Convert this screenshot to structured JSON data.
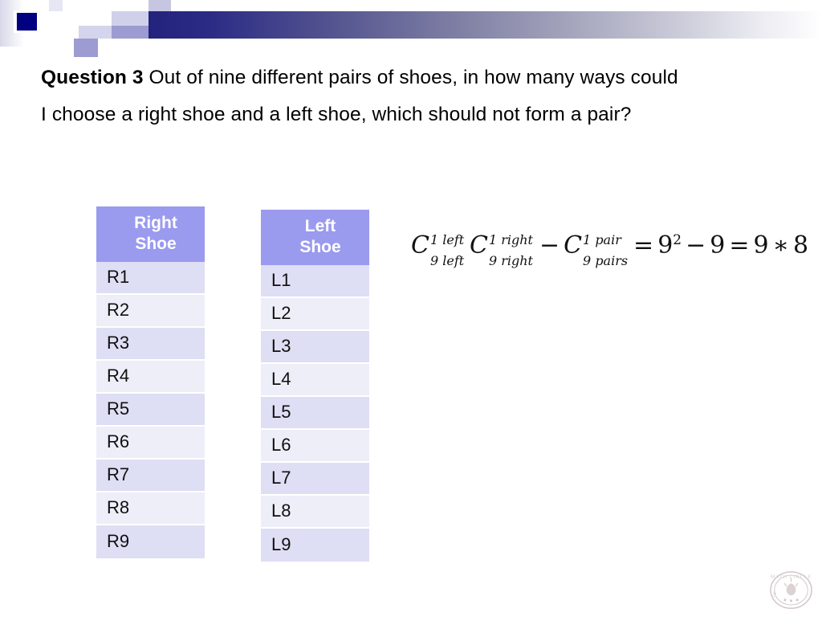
{
  "slide": {
    "background_color": "#ffffff"
  },
  "header": {
    "accent_dark": "#23237d",
    "accent_light": "#9c9cd2",
    "navy_square": "#000080"
  },
  "question": {
    "label": "Question 3",
    "text": " Out of nine different pairs of shoes, in how many ways could I choose a right shoe and a left shoe, which should not form a pair?"
  },
  "tables": {
    "header_bg": "#9a9aee",
    "row_odd_bg": "#dedef4",
    "row_even_bg": "#eeeef9",
    "right_shoe": {
      "header_line1": "Right",
      "header_line2": "Shoe",
      "rows": [
        "R1",
        "R2",
        "R3",
        "R4",
        "R5",
        "R6",
        "R7",
        "R8",
        "R9"
      ]
    },
    "left_shoe": {
      "header_line1": "Left",
      "header_line2": "Shoe",
      "rows": [
        "L1",
        "L2",
        "L3",
        "L4",
        "L5",
        "L6",
        "L7",
        "L8",
        "L9"
      ]
    }
  },
  "formula": {
    "full_text": "C_9 left^1 left  C_9 right^1 right − C_9 pairs^1 pair = 9^2 − 9 = 9 ∗ 8",
    "term1": {
      "base": "C",
      "sup": "1 left",
      "sub": "9 left"
    },
    "term2": {
      "base": "C",
      "sup": "1 right",
      "sub": "9 right"
    },
    "minus": "−",
    "term3": {
      "base": "C",
      "sup": "1 pair",
      "sub": "9 pairs"
    },
    "equals1": "=",
    "nine": "9",
    "power": "2",
    "minus2": "−",
    "nine2": "9",
    "equals2": "=",
    "nine3": "9",
    "times": "∗",
    "eight": "8"
  },
  "watermark": {
    "name": "math-circle-logo",
    "text_top": "MATH CIRCLE",
    "text_bottom": "OF"
  }
}
